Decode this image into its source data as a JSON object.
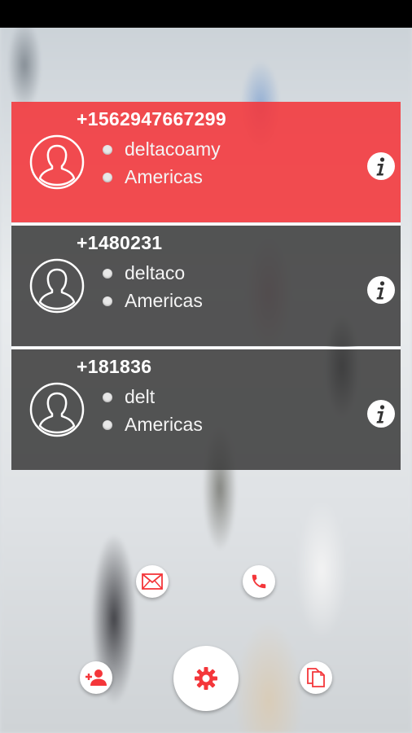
{
  "contacts": [
    {
      "number": "+1562947667299",
      "carrier": "deltacoamy",
      "region": "Americas",
      "theme": "red"
    },
    {
      "number": "+1480231",
      "carrier": "deltaco",
      "region": "Americas",
      "theme": "dark"
    },
    {
      "number": "+181836",
      "carrier": "delt",
      "region": "Americas",
      "theme": "dark"
    }
  ],
  "actions": {
    "message_icon": "envelope-icon",
    "call_icon": "phone-icon",
    "add_contact_icon": "add-contact-icon",
    "settings_icon": "gear-icon",
    "copy_icon": "copy-icon"
  },
  "colors": {
    "accent": "#f4363a",
    "card_dark": "#3a3a3a"
  }
}
